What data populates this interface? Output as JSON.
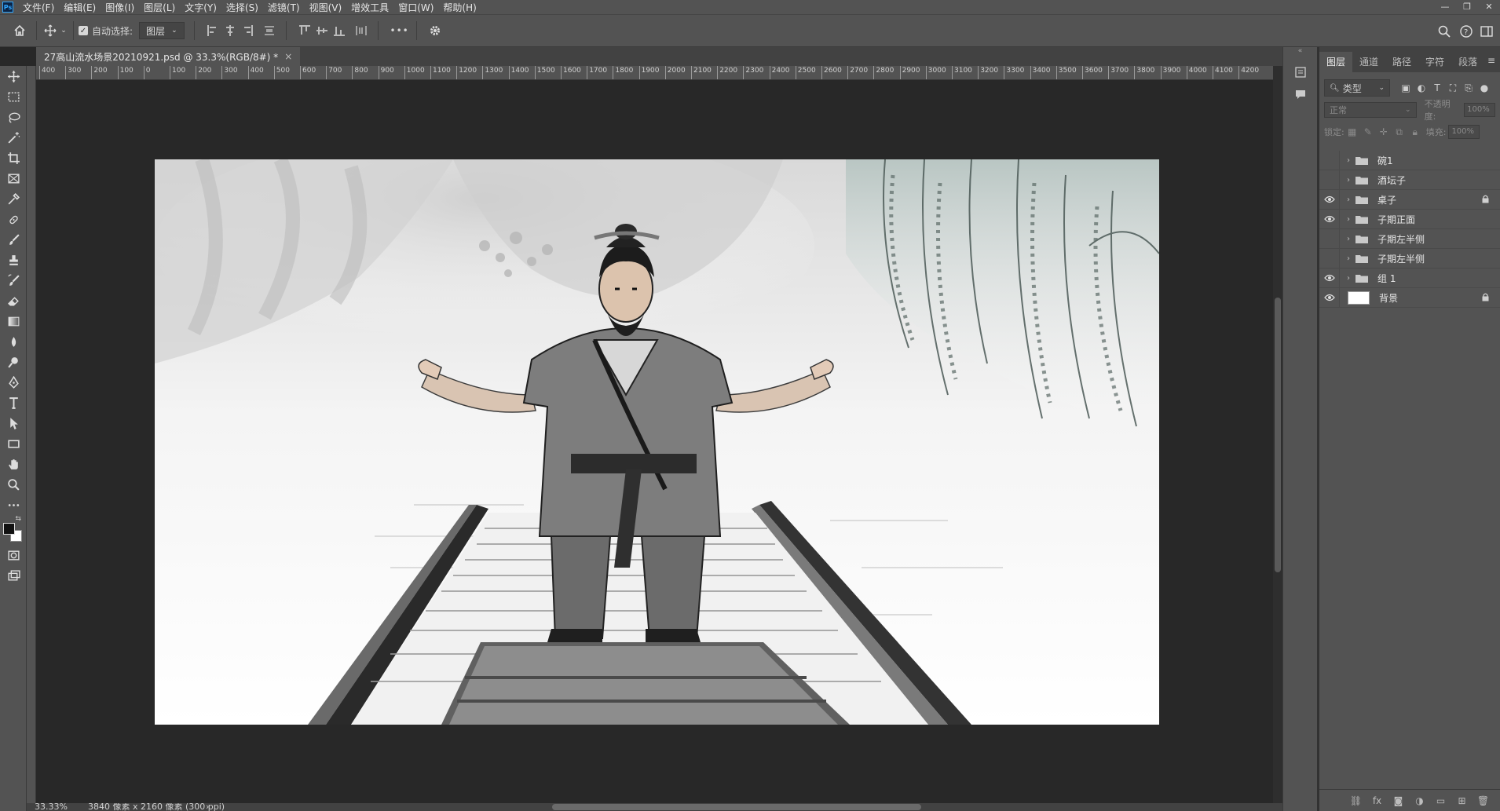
{
  "app_logo": "Ps",
  "menu": [
    "文件(F)",
    "编辑(E)",
    "图像(I)",
    "图层(L)",
    "文字(Y)",
    "选择(S)",
    "滤镜(T)",
    "视图(V)",
    "增效工具",
    "窗口(W)",
    "帮助(H)"
  ],
  "window_controls": [
    "—",
    "❐",
    "✕"
  ],
  "options_bar": {
    "auto_select_label": "自动选择:",
    "auto_select_target": "图层",
    "more_glyph": "•••"
  },
  "document": {
    "tab_title": "27高山流水场景20210921.psd @ 33.3%(RGB/8#) *",
    "close_glyph": "×"
  },
  "ruler": {
    "ticks": [
      "400",
      "300",
      "200",
      "100",
      "0",
      "100",
      "200",
      "300",
      "400",
      "500",
      "600",
      "700",
      "800",
      "900",
      "1000",
      "1100",
      "1200",
      "1300",
      "1400",
      "1500",
      "1600",
      "1700",
      "1800",
      "1900",
      "2000",
      "2100",
      "2200",
      "2300",
      "2400",
      "2500",
      "2600",
      "2700",
      "2800",
      "2900",
      "3000",
      "3100",
      "3200",
      "3300",
      "3400",
      "3500",
      "3600",
      "3700",
      "3800",
      "3900",
      "4000",
      "4100",
      "4200"
    ]
  },
  "status": {
    "zoom": "33.33%",
    "info": "3840 像素 x 2160 像素 (300 ppi)",
    "arrow": "›"
  },
  "panel": {
    "tabs": [
      "图层",
      "通道",
      "路径",
      "字符",
      "段落"
    ],
    "active_tab": "图层",
    "filter_label": "类型",
    "blend_mode": "正常",
    "opacity_label": "不透明度:",
    "opacity_value": "100%",
    "lock_label": "锁定:",
    "fill_label": "填充:",
    "fill_value": "100%"
  },
  "layers": [
    {
      "name": "碗1",
      "visible": false,
      "type": "group",
      "locked": false
    },
    {
      "name": "酒坛子",
      "visible": false,
      "type": "group",
      "locked": false
    },
    {
      "name": "桌子",
      "visible": true,
      "type": "group",
      "locked": true
    },
    {
      "name": "子期正面",
      "visible": true,
      "type": "group",
      "locked": false
    },
    {
      "name": "子期左半侧",
      "visible": false,
      "type": "group",
      "locked": false
    },
    {
      "name": "子期左半侧",
      "visible": false,
      "type": "group",
      "locked": false
    },
    {
      "name": "组 1",
      "visible": true,
      "type": "group",
      "locked": false
    },
    {
      "name": "背景",
      "visible": true,
      "type": "image",
      "locked": true
    }
  ],
  "colors": {
    "foreground": "#111111",
    "background": "#ffffff",
    "ps_blue": "#31a8ff"
  }
}
